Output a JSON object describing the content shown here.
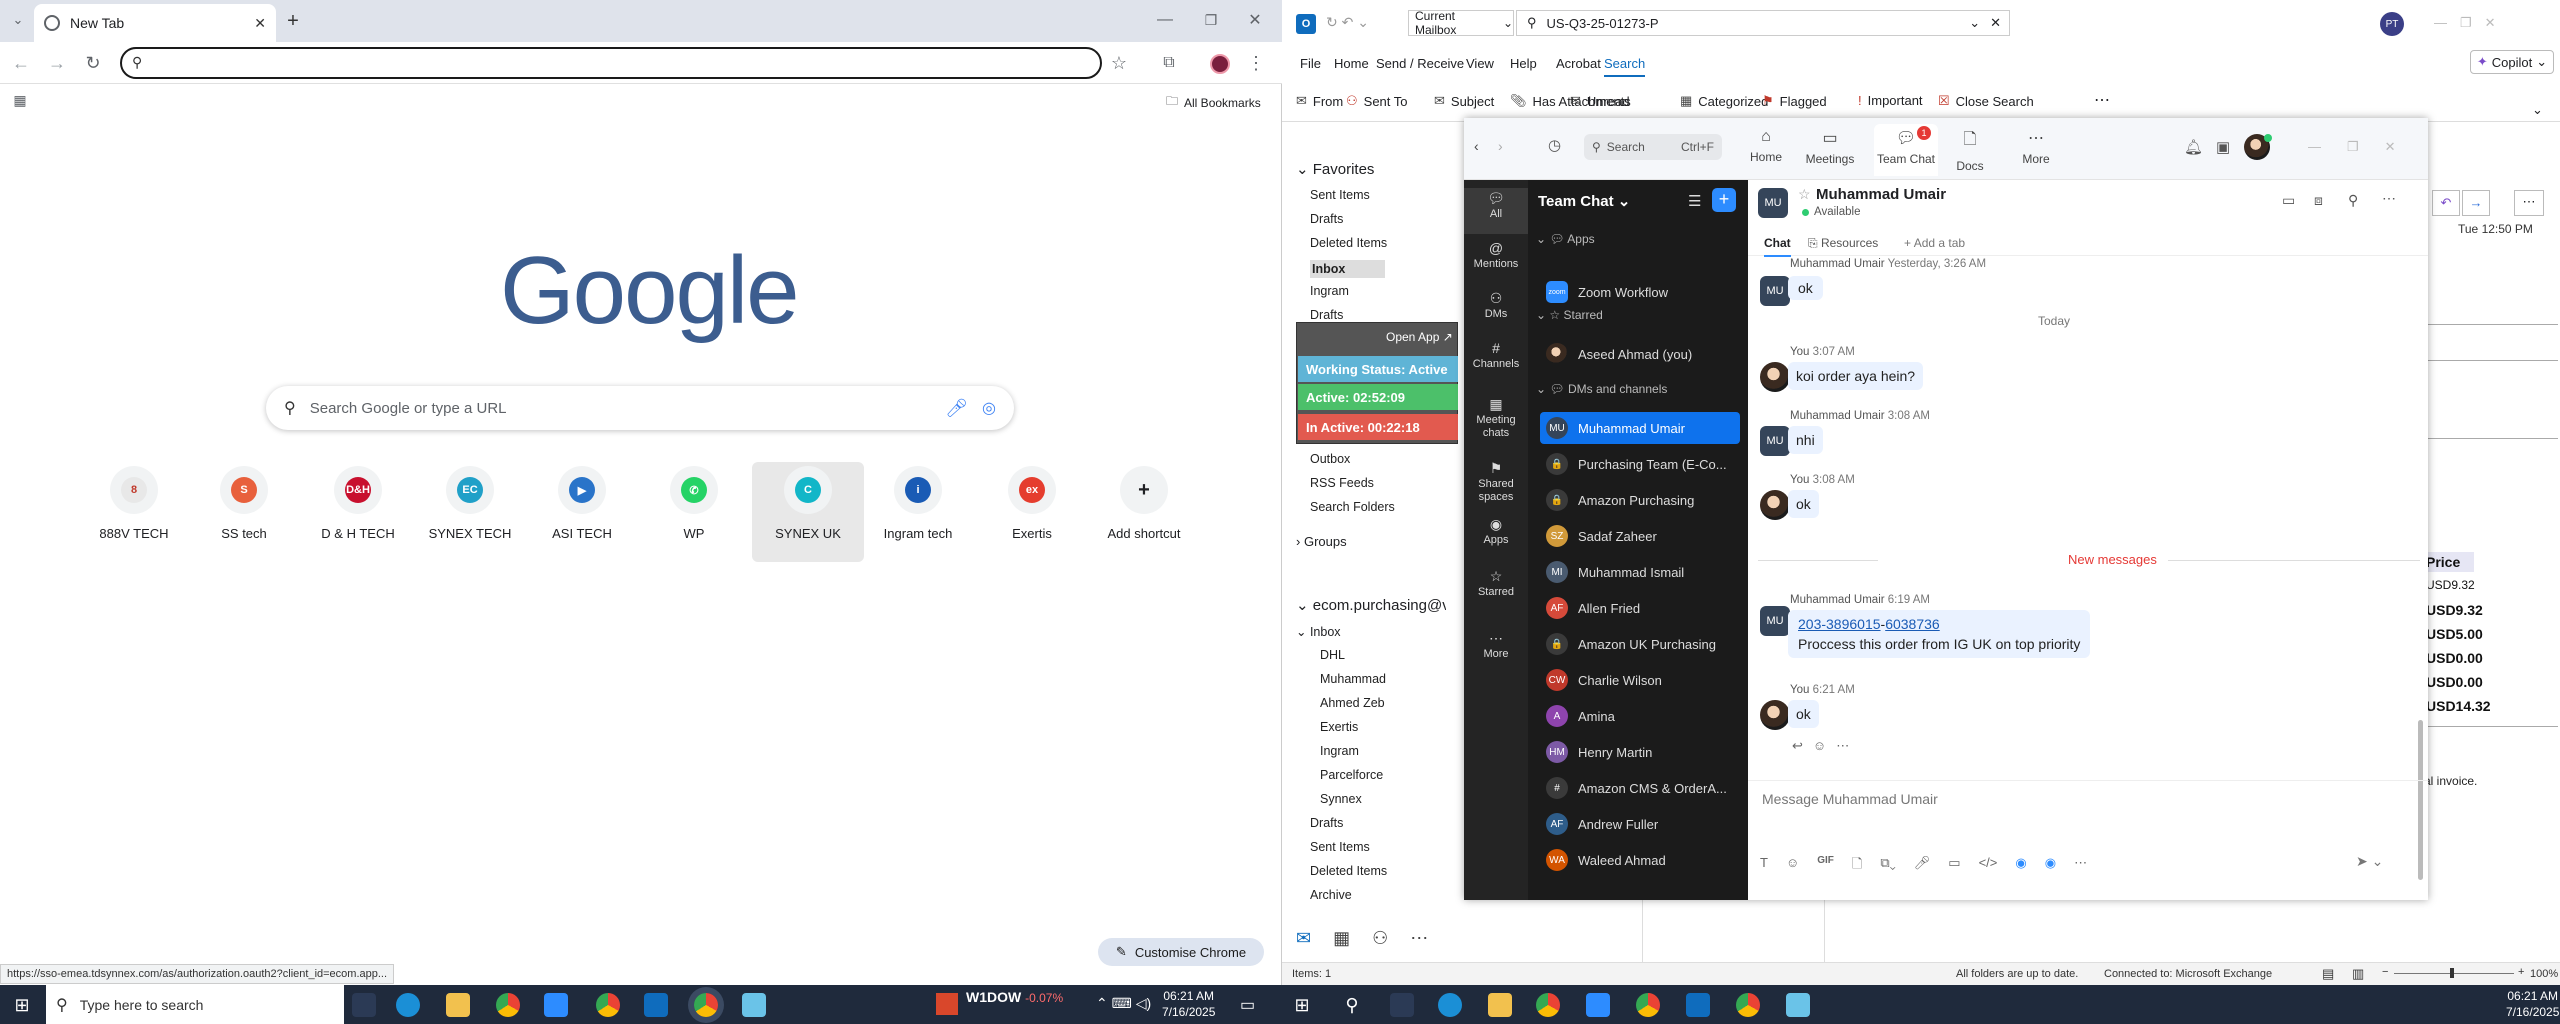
{
  "chrome": {
    "tab_title": "New Tab",
    "bookmarks_label": "All Bookmarks",
    "search_placeholder": "Search Google or type a URL",
    "logo": "Google",
    "shortcuts": [
      {
        "label": "888V TECH",
        "color": "#e8e8e8",
        "glyph": "8",
        "glyph_color": "#c0392b"
      },
      {
        "label": "SS tech",
        "color": "#e8603c",
        "glyph": "S"
      },
      {
        "label": "D & H TECH",
        "color": "#c8102e",
        "glyph": "D&H"
      },
      {
        "label": "SYNEX TECH",
        "color": "#20a0c8",
        "glyph": "EC"
      },
      {
        "label": "ASI TECH",
        "color": "#2a74c9",
        "glyph": "▶"
      },
      {
        "label": "WP",
        "color": "#25d366",
        "glyph": "✆"
      },
      {
        "label": "SYNEX UK",
        "color": "#12b6c8",
        "glyph": "C"
      },
      {
        "label": "Ingram tech",
        "color": "#1a5bb5",
        "glyph": "i"
      },
      {
        "label": "Exertis",
        "color": "#e53d2e",
        "glyph": "ex"
      },
      {
        "label": "Add shortcut",
        "color": "#f1f3f4",
        "glyph": "+"
      }
    ],
    "customise_label": "Customise Chrome",
    "status_url": "https://sso-emea.tdsynnex.com/as/authorization.oauth2?client_id=ecom.app..."
  },
  "taskbar_left": {
    "search_placeholder": "Type here to search",
    "stock_name": "W1DOW",
    "stock_change": "-0.07%",
    "time": "06:21 AM",
    "date": "7/16/2025"
  },
  "taskbar_right": {
    "time": "06:21 AM",
    "date": "7/16/2025"
  },
  "outlook": {
    "mailbox_scope": "Current Mailbox",
    "search_value": "US-Q3-25-01273-P",
    "user_initials": "PT",
    "copilot_label": "Copilot",
    "menu": [
      "File",
      "Home",
      "Send / Receive",
      "View",
      "Help",
      "Acrobat",
      "Search"
    ],
    "ribbon": [
      "From",
      "Sent To",
      "Subject",
      "Has Attachments",
      "Unread",
      "Categorized",
      "Flagged",
      "Important",
      "Close Search"
    ],
    "favorites_header": "Favorites",
    "favorites": [
      "Sent Items",
      "Drafts",
      "Deleted Items",
      "Inbox",
      "Ingram",
      "Drafts",
      "Sent Items"
    ],
    "more_folders": [
      "Outbox",
      "RSS Feeds",
      "Search Folders"
    ],
    "groups_label": "Groups",
    "account": "ecom.purchasing@vcloud",
    "account_inbox": "Inbox",
    "inbox_subfolders": [
      "DHL",
      "Muhammad",
      "Ahmed Zeb",
      "Exertis",
      "Ingram",
      "Parcelforce",
      "Synnex"
    ],
    "account_folders": [
      "Drafts",
      "Sent Items",
      "Deleted Items",
      "Archive"
    ],
    "status_items": "Items: 1",
    "status_sync": "All folders are up to date.",
    "status_conn": "Connected to: Microsoft Exchange",
    "zoom_level": "100%",
    "reading_date": "Tue 12:50 PM",
    "price_header": "Price",
    "prices": [
      "USD9.32",
      "USD9.32",
      "USD5.00",
      "USD0.00",
      "USD0.00",
      "USD14.32"
    ],
    "invoice_note": "al invoice."
  },
  "work_status": {
    "open_app": "Open App",
    "status": "Working Status: Active",
    "active": "Active: 02:52:09",
    "inactive": "In Active: 00:22:18"
  },
  "zoom": {
    "search_label": "Search",
    "search_shortcut": "Ctrl+F",
    "nav": [
      "Home",
      "Meetings",
      "Team Chat",
      "Docs",
      "More"
    ],
    "docs_badge": "1",
    "left_nav": [
      "All",
      "Mentions",
      "DMs",
      "Channels",
      "Meeting chats",
      "Shared spaces",
      "Apps",
      "Starred",
      "More"
    ],
    "list_header": "Team Chat",
    "sections": {
      "apps": "Apps",
      "starred": "Starred",
      "dms": "DMs and channels"
    },
    "app_items": [
      "Zoom Workflow"
    ],
    "starred_items": [
      "Aseed Ahmad (you)"
    ],
    "chat_items": [
      {
        "name": "Muhammad Umair",
        "initials": "MU",
        "color": "#35455a"
      },
      {
        "name": "Purchasing Team (E-Co...",
        "initials": "🔒",
        "color": "#3a3a3a"
      },
      {
        "name": "Amazon Purchasing",
        "initials": "🔒",
        "color": "#3a3a3a"
      },
      {
        "name": "Sadaf Zaheer",
        "initials": "SZ",
        "color": "#d19a3a"
      },
      {
        "name": "Muhammad Ismail",
        "initials": "MI",
        "color": "#4a5b70"
      },
      {
        "name": "Allen Fried",
        "initials": "AF",
        "color": "#d64a3a"
      },
      {
        "name": "Amazon UK Purchasing",
        "initials": "🔒",
        "color": "#3a3a3a"
      },
      {
        "name": "Charlie Wilson",
        "initials": "CW",
        "color": "#c0392b"
      },
      {
        "name": "Amina",
        "initials": "A",
        "color": "#8e44ad"
      },
      {
        "name": "Henry Martin",
        "initials": "HM",
        "color": "#7d5aa6"
      },
      {
        "name": "Amazon CMS & OrderA...",
        "initials": "#",
        "color": "#3a3a3a"
      },
      {
        "name": "Andrew Fuller",
        "initials": "AF",
        "color": "#2e5d8a"
      },
      {
        "name": "Waleed Ahmad",
        "initials": "WA",
        "color": "#d35400"
      }
    ],
    "contact": {
      "name": "Muhammad Umair",
      "initials": "MU",
      "status": "Available"
    },
    "tabs": [
      "Chat",
      "Resources",
      "Add a tab"
    ],
    "day_separator": "Today",
    "new_messages": "New messages",
    "messages": [
      {
        "who": "Muhammad Umair",
        "time": "Yesterday, 3:26 AM",
        "text": "ok",
        "mine": false
      },
      {
        "who": "You",
        "time": "3:07 AM",
        "text": "koi order aya hein?",
        "mine": true
      },
      {
        "who": "Muhammad Umair",
        "time": "3:08 AM",
        "text": "nhi",
        "mine": false
      },
      {
        "who": "You",
        "time": "3:08 AM",
        "text": "ok",
        "mine": true
      },
      {
        "who": "Muhammad Umair",
        "time": "6:19 AM",
        "text_link_a": "203-3896015",
        "text_link_sep": "-",
        "text_link_b": "6038736",
        "text2": "Proccess this order from IG UK on top priority",
        "mine": false
      },
      {
        "who": "You",
        "time": "6:21 AM",
        "text": "ok",
        "mine": true
      }
    ],
    "composer_placeholder": "Message Muhammad Umair"
  }
}
